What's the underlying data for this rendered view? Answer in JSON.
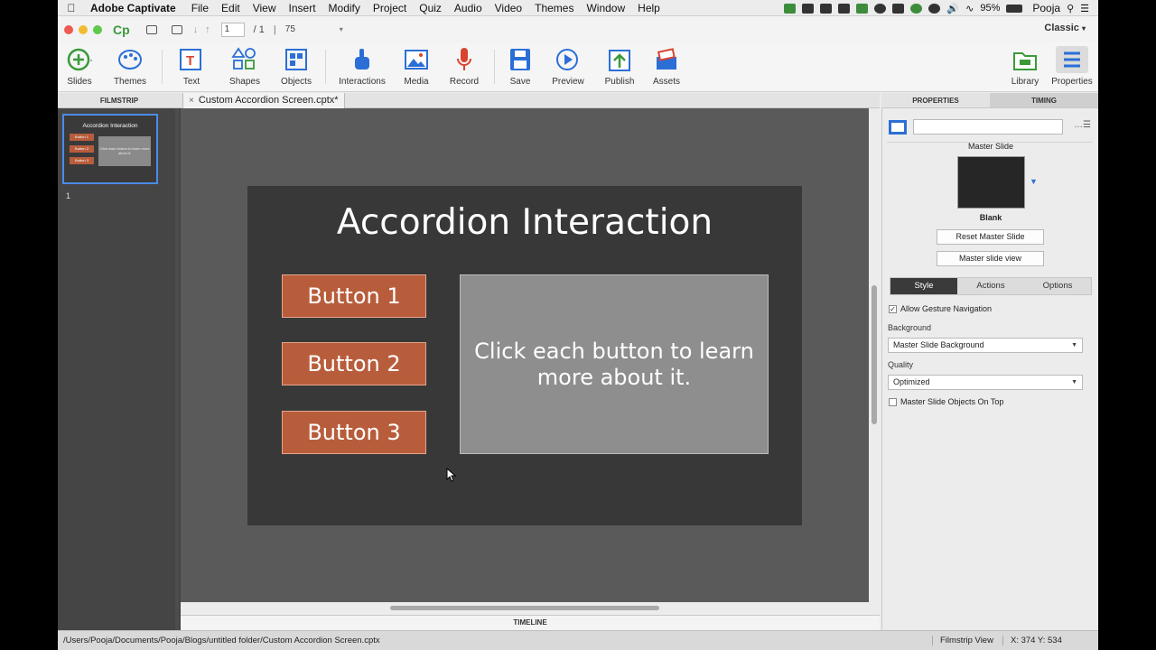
{
  "menubar": {
    "app_name": "Adobe Captivate",
    "items": [
      "File",
      "Edit",
      "View",
      "Insert",
      "Modify",
      "Project",
      "Quiz",
      "Audio",
      "Video",
      "Themes",
      "Window",
      "Help"
    ],
    "battery": "95%",
    "user": "Pooja"
  },
  "titlebar": {
    "logo": "Cp",
    "slide_number": "1",
    "slide_total": "/ 1",
    "separator": "|",
    "zoom": "75",
    "workspace": "Classic"
  },
  "toolbar": {
    "slides": "Slides",
    "themes": "Themes",
    "text": "Text",
    "shapes": "Shapes",
    "objects": "Objects",
    "interactions": "Interactions",
    "media": "Media",
    "record": "Record",
    "save": "Save",
    "preview": "Preview",
    "publish": "Publish",
    "assets": "Assets",
    "library": "Library",
    "properties": "Properties"
  },
  "filmstrip": {
    "header": "FILMSTRIP",
    "slide_index": "1",
    "thumb_title": "Accordion Interaction",
    "thumb_buttons": [
      "Button 1",
      "Button 2",
      "Button 3"
    ],
    "thumb_text": "Click each button to learn more about it."
  },
  "document": {
    "tab_title": "Custom Accordion Screen.cptx*",
    "close": "×"
  },
  "slide": {
    "title": "Accordion Interaction",
    "buttons": [
      "Button 1",
      "Button 2",
      "Button 3"
    ],
    "info_text": "Click each button to learn more about it."
  },
  "timeline": {
    "label": "TIMELINE"
  },
  "properties": {
    "tab_properties": "PROPERTIES",
    "tab_timing": "TIMING",
    "master_slide_label": "Master Slide",
    "master_slide_name": "Blank",
    "reset_button": "Reset Master Slide",
    "view_button": "Master slide view",
    "subtabs": [
      "Style",
      "Actions",
      "Options"
    ],
    "allow_gesture": "Allow Gesture Navigation",
    "background_label": "Background",
    "background_value": "Master Slide Background",
    "quality_label": "Quality",
    "quality_value": "Optimized",
    "master_objects_top": "Master Slide Objects On Top"
  },
  "statusbar": {
    "path": "/Users/Pooja/Documents/Pooja/Blogs/untitled folder/Custom Accordion Screen.cptx",
    "view_mode": "Filmstrip View",
    "coords": "X: 374 Y: 534"
  },
  "colors": {
    "accent": "#2b6fd6",
    "slide_button": "#b85d3c",
    "slide_bg": "#383838",
    "stage_bg": "#5a5a5a"
  }
}
